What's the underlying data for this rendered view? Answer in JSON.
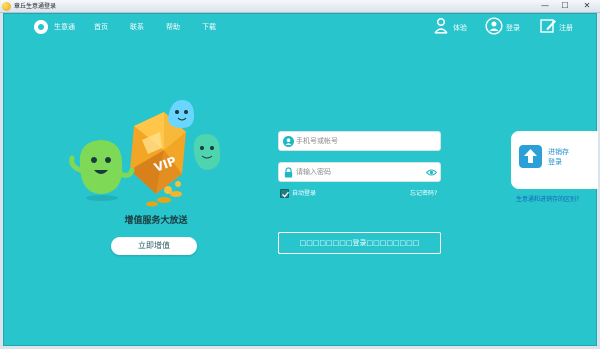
{
  "window": {
    "title": "章丘生意通登录",
    "minimize": "—",
    "maximize": "☐",
    "close": "✕"
  },
  "nav": {
    "brand": "生意通",
    "links": [
      "首页",
      "联系",
      "帮助",
      "下载"
    ]
  },
  "top_right": {
    "experience": "体验",
    "login": "登录",
    "register": "注册"
  },
  "promo": {
    "badge_text": "VIP",
    "text": "增值服务大放送",
    "button": "立即增值"
  },
  "form": {
    "account_placeholder": "手机号或帐号",
    "password_placeholder": "请输入密码",
    "remember_label": "自动登录",
    "remember_checked": true,
    "forgot_label": "忘记密码?",
    "login_button": "□□□□□□□□登录□□□□□□□□"
  },
  "side_panel": {
    "title": "进销存",
    "subtitle": "登录",
    "link": "生意通和进销存的区别?"
  },
  "colors": {
    "background": "#28c5cd",
    "side_text": "#1a8ecb"
  }
}
